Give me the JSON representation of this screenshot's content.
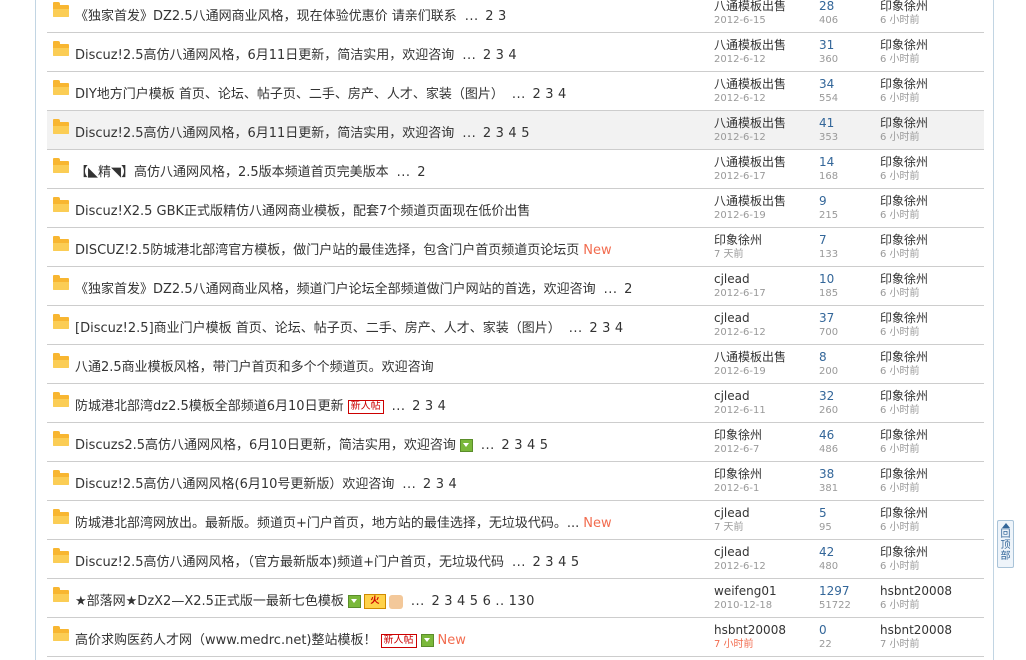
{
  "threads": [
    {
      "title": "《独家首发》DZ2.5八通网商业风格，现在体验优惠价 请亲们联系",
      "pages": [
        "2",
        "3"
      ],
      "author": "八通模板出售",
      "date": "2012-6-15",
      "replies": "28",
      "views": "406",
      "last_user": "印象徐州",
      "last_time": "6 小时前"
    },
    {
      "title": "Discuz!2.5高仿八通网风格，6月11日更新，简洁实用，欢迎咨询",
      "pages": [
        "2",
        "3",
        "4"
      ],
      "author": "八通模板出售",
      "date": "2012-6-12",
      "replies": "31",
      "views": "360",
      "last_user": "印象徐州",
      "last_time": "6 小时前"
    },
    {
      "title": "DIY地方门户模板 首页、论坛、帖子页、二手、房产、人才、家装（图片）",
      "pages": [
        "2",
        "3",
        "4"
      ],
      "author": "八通模板出售",
      "date": "2012-6-12",
      "replies": "34",
      "views": "554",
      "last_user": "印象徐州",
      "last_time": "6 小时前"
    },
    {
      "title": "Discuz!2.5高仿八通网风格，6月11日更新，简洁实用，欢迎咨询",
      "pages": [
        "2",
        "3",
        "4",
        "5"
      ],
      "author": "八通模板出售",
      "date": "2012-6-12",
      "replies": "41",
      "views": "353",
      "last_user": "印象徐州",
      "last_time": "6 小时前"
    },
    {
      "title": "【◣精◥】高仿八通网风格，2.5版本频道首页完美版本",
      "pages": [
        "2"
      ],
      "author": "八通模板出售",
      "date": "2012-6-17",
      "replies": "14",
      "views": "168",
      "last_user": "印象徐州",
      "last_time": "6 小时前"
    },
    {
      "title": "Discuz!X2.5 GBK正式版精仿八通网商业模板，配套7个频道页面现在低价出售",
      "pages": [],
      "author": "八通模板出售",
      "date": "2012-6-19",
      "replies": "9",
      "views": "215",
      "last_user": "印象徐州",
      "last_time": "6 小时前"
    },
    {
      "title": "DISCUZ!2.5防城港北部湾官方模板，做门户站的最佳选择，包含门户首页频道页论坛页",
      "pages": [],
      "new": "New",
      "author": "印象徐州",
      "date": "7 天前",
      "replies": "7",
      "views": "133",
      "last_user": "印象徐州",
      "last_time": "6 小时前"
    },
    {
      "title": "《独家首发》DZ2.5八通网商业风格，频道门户论坛全部频道做门户网站的首选，欢迎咨询",
      "pages": [
        "2"
      ],
      "author": "cjlead",
      "date": "2012-6-17",
      "replies": "10",
      "views": "185",
      "last_user": "印象徐州",
      "last_time": "6 小时前"
    },
    {
      "title": "[Discuz!2.5]商业门户模板 首页、论坛、帖子页、二手、房产、人才、家装（图片）",
      "pages": [
        "2",
        "3",
        "4"
      ],
      "author": "cjlead",
      "date": "2012-6-12",
      "replies": "37",
      "views": "700",
      "last_user": "印象徐州",
      "last_time": "6 小时前"
    },
    {
      "title": "八通2.5商业模板风格，带门户首页和多个个频道页。欢迎咨询",
      "pages": [],
      "author": "八通模板出售",
      "date": "2012-6-19",
      "replies": "8",
      "views": "200",
      "last_user": "印象徐州",
      "last_time": "6 小时前"
    },
    {
      "title": "防城港北部湾dz2.5模板全部频道6月10日更新",
      "badge": "新人帖",
      "pages": [
        "2",
        "3",
        "4"
      ],
      "author": "cjlead",
      "date": "2012-6-11",
      "replies": "32",
      "views": "260",
      "last_user": "印象徐州",
      "last_time": "6 小时前"
    },
    {
      "title": "Discuzs2.5高仿八通网风格，6月10日更新，简洁实用，欢迎咨询",
      "img": true,
      "pages": [
        "2",
        "3",
        "4",
        "5"
      ],
      "author": "印象徐州",
      "date": "2012-6-7",
      "replies": "46",
      "views": "486",
      "last_user": "印象徐州",
      "last_time": "6 小时前"
    },
    {
      "title": "Discuz!2.5高仿八通网风格(6月10号更新版）欢迎咨询",
      "pages": [
        "2",
        "3",
        "4"
      ],
      "author": "印象徐州",
      "date": "2012-6-1",
      "replies": "38",
      "views": "381",
      "last_user": "印象徐州",
      "last_time": "6 小时前"
    },
    {
      "title": "防城港北部湾网放出。最新版。频道页+门户首页，地方站的最佳选择，无垃圾代码。...",
      "pages": [],
      "new": "New",
      "author": "cjlead",
      "date": "7 天前",
      "replies": "5",
      "views": "95",
      "last_user": "印象徐州",
      "last_time": "6 小时前"
    },
    {
      "title": "Discuz!2.5高仿八通网风格，（官方最新版本)频道+门户首页，无垃圾代码",
      "pages": [
        "2",
        "3",
        "4",
        "5"
      ],
      "author": "cjlead",
      "date": "2012-6-12",
      "replies": "42",
      "views": "480",
      "last_user": "印象徐州",
      "last_time": "6 小时前"
    },
    {
      "title": "★部落网★DzX2—X2.5正式版一最新七色模板",
      "img": true,
      "hot": "火",
      "thumb": true,
      "pages": [
        "2",
        "3",
        "4",
        "5",
        "6",
        "..",
        "130"
      ],
      "author": "weifeng01",
      "date": "2010-12-18",
      "replies": "1297",
      "views": "51722",
      "last_user": "hsbnt20008",
      "last_time": "6 小时前"
    },
    {
      "title": "高价求购医药人才网（www.medrc.net)整站模板！",
      "badge": "新人帖",
      "img": true,
      "new": "New",
      "pages": [],
      "author": "hsbnt20008",
      "date": "7 小时前",
      "date_red": true,
      "replies": "0",
      "views": "22",
      "last_user": "hsbnt20008",
      "last_time": "7 小时前"
    }
  ],
  "back_to_top": "回顶部",
  "highlight_row": 3
}
